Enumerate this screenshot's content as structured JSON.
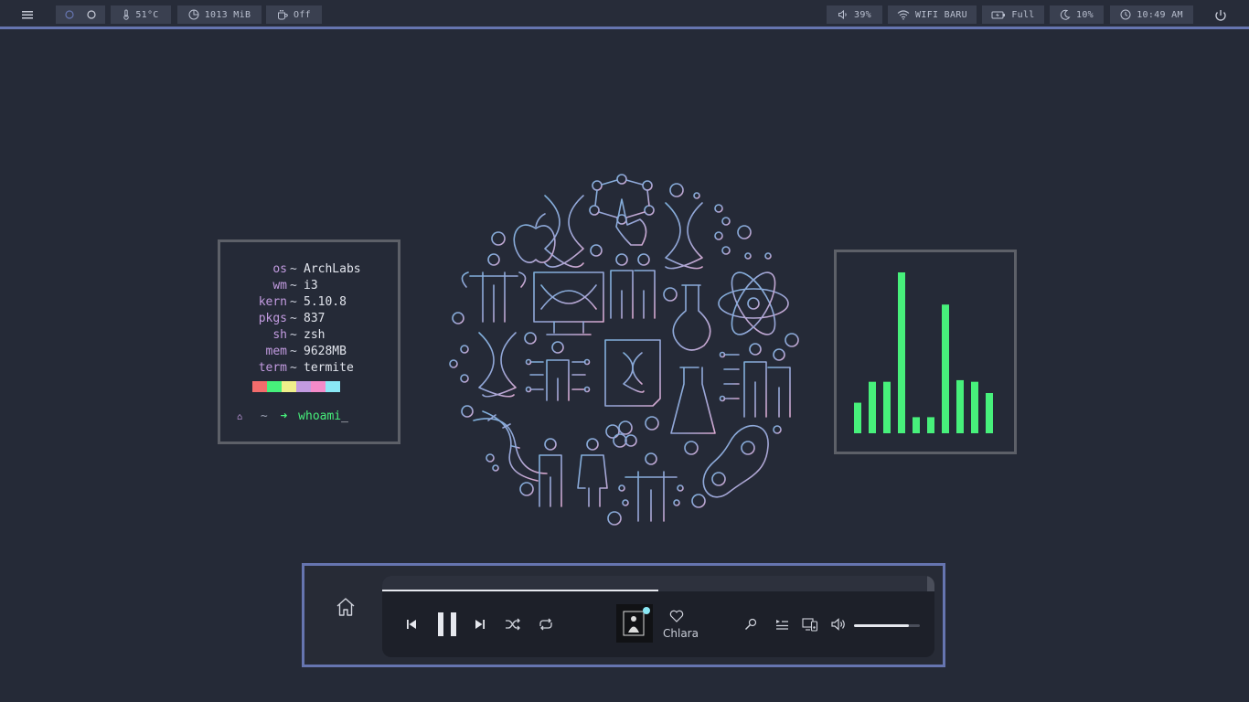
{
  "topbar": {
    "left": {
      "workspaces": [
        "workspace-1",
        "workspace-2"
      ],
      "temperature": "51°C",
      "memory": "1013 MiB",
      "caffeine": "Off"
    },
    "right": {
      "volume": "39%",
      "wifi": "WIFI BARU",
      "battery": "Full",
      "brightness": "10%",
      "clock": "10:49 AM"
    }
  },
  "info": {
    "rows": [
      {
        "key": "os",
        "value": "ArchLabs"
      },
      {
        "key": "wm",
        "value": "i3"
      },
      {
        "key": "kern",
        "value": "5.10.8"
      },
      {
        "key": "pkgs",
        "value": "837"
      },
      {
        "key": "sh",
        "value": "zsh"
      },
      {
        "key": "mem",
        "value": "9628MB"
      },
      {
        "key": "term",
        "value": "termite"
      }
    ],
    "separator": "~",
    "swatch_colors": [
      "#f36c6c",
      "#47f07b",
      "#efef8a",
      "#c29be0",
      "#f48bc9",
      "#8ae8f5"
    ],
    "prompt": {
      "dir": "~",
      "command": "whoami",
      "cursor": "_"
    }
  },
  "visualizer": {
    "bar_color": "#47f07b",
    "levels": [
      0.19,
      0.32,
      0.32,
      1.0,
      0.1,
      0.1,
      0.8,
      0.33,
      0.32,
      0.25
    ]
  },
  "player": {
    "progress": 0.5,
    "volume": 0.83,
    "track": "Chlara",
    "controls": [
      "previous-icon",
      "pause-icon",
      "next-icon",
      "shuffle-icon",
      "repeat-icon",
      "heart-icon",
      "lyrics-icon",
      "queue-icon",
      "devices-icon",
      "speaker-icon"
    ]
  },
  "colors": {
    "accent": "#6675b0",
    "background": "#252a37",
    "art_blue": "#7fa4d9",
    "art_pink": "#d8a8cf"
  }
}
